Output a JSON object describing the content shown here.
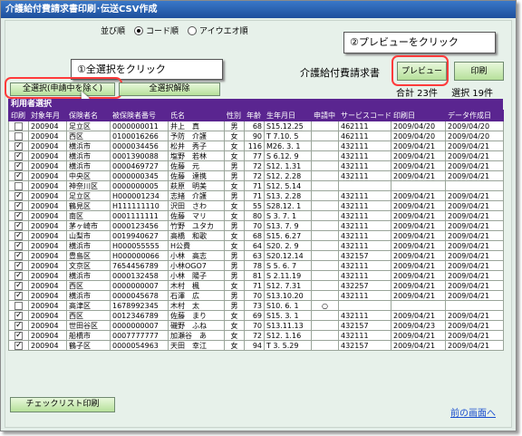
{
  "window": {
    "title": "介護給付費請求書印刷･伝送CSV作成"
  },
  "sort": {
    "label": "並び順",
    "options": [
      {
        "label": "コード順",
        "selected": true
      },
      {
        "label": "アイウエオ順",
        "selected": false
      }
    ]
  },
  "callouts": {
    "preview_hint": "②プレビューをクリック",
    "selectall_hint": "①全選択をクリック"
  },
  "header": {
    "doc_title": "介護給付費請求書",
    "preview_label": "プレビュー",
    "print_label": "印刷"
  },
  "toolbar": {
    "select_all_label": "全選択(申請中を除く)",
    "clear_all_label": "全選択解除"
  },
  "totals": {
    "total": "合計 23件",
    "selected": "選択 19件"
  },
  "section_label": "利用者選択",
  "table": {
    "columns": [
      "印刷",
      "対象年月",
      "保険者名",
      "被保険者番号",
      "氏名",
      "性別",
      "年齢",
      "生年月日",
      "申請中",
      "サービスコード",
      "印刷日",
      "データ作成日"
    ],
    "rows": [
      {
        "checked": false,
        "ym": "200904",
        "insurer": "足立区",
        "no": "0000000011",
        "name": "井上　真",
        "sex": "男",
        "age": "68",
        "birth": "S15.12.25",
        "pending": "",
        "svc": "462111",
        "printed": "2009/04/20",
        "created": "2009/04/20"
      },
      {
        "checked": false,
        "ym": "200904",
        "insurer": "西区",
        "no": "0100016266",
        "name": "予防　介護",
        "sex": "女",
        "age": "90",
        "birth": "T 7.10. 5",
        "pending": "",
        "svc": "462111",
        "printed": "2009/04/20",
        "created": "2009/04/20"
      },
      {
        "checked": true,
        "ym": "200904",
        "insurer": "横浜市",
        "no": "0000034456",
        "name": "松井　秀子",
        "sex": "女",
        "age": "116",
        "birth": "M26. 3. 1",
        "pending": "",
        "svc": "432111",
        "printed": "2009/04/21",
        "created": "2009/04/21"
      },
      {
        "checked": true,
        "ym": "200904",
        "insurer": "横浜市",
        "no": "0001390088",
        "name": "塩野　若林",
        "sex": "女",
        "age": "77",
        "birth": "S 6.12. 9",
        "pending": "",
        "svc": "432111",
        "printed": "2009/04/21",
        "created": "2009/04/21"
      },
      {
        "checked": true,
        "ym": "200904",
        "insurer": "横浜市",
        "no": "0000469727",
        "name": "佐藤　元",
        "sex": "男",
        "age": "72",
        "birth": "S12. 1.31",
        "pending": "",
        "svc": "432111",
        "printed": "2009/04/21",
        "created": "2009/04/21"
      },
      {
        "checked": true,
        "ym": "200904",
        "insurer": "中央区",
        "no": "0000000345",
        "name": "佐藤　達携",
        "sex": "男",
        "age": "72",
        "birth": "S12. 2.28",
        "pending": "",
        "svc": "432111",
        "printed": "2009/04/21",
        "created": "2009/04/21"
      },
      {
        "checked": false,
        "ym": "200904",
        "insurer": "神奈川区",
        "no": "0000000005",
        "name": "萩原　明美",
        "sex": "女",
        "age": "71",
        "birth": "S12. 5.14",
        "pending": "",
        "svc": "",
        "printed": "",
        "created": ""
      },
      {
        "checked": true,
        "ym": "200904",
        "insurer": "足立区",
        "no": "H000001234",
        "name": "志緒　介護",
        "sex": "男",
        "age": "71",
        "birth": "S13. 2.28",
        "pending": "",
        "svc": "432111",
        "printed": "2009/04/21",
        "created": "2009/04/21"
      },
      {
        "checked": true,
        "ym": "200904",
        "insurer": "鶴見区",
        "no": "H111111110",
        "name": "沢田　さわ",
        "sex": "女",
        "age": "55",
        "birth": "S28.12. 1",
        "pending": "",
        "svc": "432111",
        "printed": "2009/04/21",
        "created": "2009/04/21"
      },
      {
        "checked": true,
        "ym": "200904",
        "insurer": "南区",
        "no": "0001111111",
        "name": "佐藤　マリ",
        "sex": "女",
        "age": "80",
        "birth": "S 3. 7. 1",
        "pending": "",
        "svc": "432111",
        "printed": "2009/04/21",
        "created": "2009/04/21"
      },
      {
        "checked": true,
        "ym": "200904",
        "insurer": "茅ヶ崎市",
        "no": "0000123456",
        "name": "竹野　ユタカ",
        "sex": "男",
        "age": "70",
        "birth": "S13. 7. 9",
        "pending": "",
        "svc": "432111",
        "printed": "2009/04/21",
        "created": "2009/04/21"
      },
      {
        "checked": true,
        "ym": "200904",
        "insurer": "山梨市",
        "no": "0019940627",
        "name": "高橋　和歌",
        "sex": "女",
        "age": "68",
        "birth": "S15. 6.27",
        "pending": "",
        "svc": "432111",
        "printed": "2009/04/21",
        "created": "2009/04/21"
      },
      {
        "checked": true,
        "ym": "200904",
        "insurer": "横浜市",
        "no": "H000055555",
        "name": "H公費",
        "sex": "女",
        "age": "64",
        "birth": "S20. 2. 9",
        "pending": "",
        "svc": "432111",
        "printed": "2009/04/21",
        "created": "2009/04/21"
      },
      {
        "checked": true,
        "ym": "200904",
        "insurer": "豊島区",
        "no": "H000000066",
        "name": "小林　高志",
        "sex": "男",
        "age": "63",
        "birth": "S20.12.14",
        "pending": "",
        "svc": "432157",
        "printed": "2009/04/21",
        "created": "2009/04/21"
      },
      {
        "checked": true,
        "ym": "200904",
        "insurer": "文京区",
        "no": "7654456789",
        "name": "小林OGO7",
        "sex": "男",
        "age": "78",
        "birth": "S 5. 6. 7",
        "pending": "",
        "svc": "432111",
        "printed": "2009/04/21",
        "created": "2009/04/21"
      },
      {
        "checked": true,
        "ym": "200904",
        "insurer": "横浜市",
        "no": "0000132458",
        "name": "小林　陽子",
        "sex": "男",
        "age": "81",
        "birth": "S 2.11.19",
        "pending": "",
        "svc": "432111",
        "printed": "2009/04/21",
        "created": "2009/04/21"
      },
      {
        "checked": true,
        "ym": "200904",
        "insurer": "西区",
        "no": "0000000007",
        "name": "木村　楓",
        "sex": "女",
        "age": "71",
        "birth": "S12. 7.31",
        "pending": "",
        "svc": "432257",
        "printed": "2009/04/21",
        "created": "2009/04/21"
      },
      {
        "checked": true,
        "ym": "200904",
        "insurer": "横浜市",
        "no": "0000045678",
        "name": "石澤　広",
        "sex": "男",
        "age": "70",
        "birth": "S13.10.20",
        "pending": "",
        "svc": "432111",
        "printed": "2009/04/21",
        "created": "2009/04/21"
      },
      {
        "checked": false,
        "ym": "200904",
        "insurer": "高津区",
        "no": "1678992345",
        "name": "木村　太",
        "sex": "男",
        "age": "73",
        "birth": "S10. 6. 1",
        "pending": "○",
        "svc": "",
        "printed": "",
        "created": ""
      },
      {
        "checked": true,
        "ym": "200904",
        "insurer": "西区",
        "no": "0012346789",
        "name": "佐藤　まり",
        "sex": "女",
        "age": "69",
        "birth": "S15. 3. 1",
        "pending": "",
        "svc": "432111",
        "printed": "2009/04/21",
        "created": "2009/04/21"
      },
      {
        "checked": true,
        "ym": "200904",
        "insurer": "世田谷区",
        "no": "0000000007",
        "name": "磯野　ふね",
        "sex": "女",
        "age": "70",
        "birth": "S13.11.13",
        "pending": "",
        "svc": "432157",
        "printed": "2009/04/23",
        "created": "2009/04/21"
      },
      {
        "checked": true,
        "ym": "200904",
        "insurer": "船橋市",
        "no": "0007777777",
        "name": "加瀬谷　あ",
        "sex": "女",
        "age": "72",
        "birth": "S12. 1.16",
        "pending": "",
        "svc": "432111",
        "printed": "2009/04/21",
        "created": "2009/04/21"
      },
      {
        "checked": true,
        "ym": "200904",
        "insurer": "鶴子区",
        "no": "0000054963",
        "name": "天田　幸江",
        "sex": "女",
        "age": "94",
        "birth": "T 3. 5.29",
        "pending": "",
        "svc": "432157",
        "printed": "2009/04/21",
        "created": "2009/04/21"
      }
    ]
  },
  "footer": {
    "checklist_label": "チェックリスト印刷",
    "back_link": "前の画面へ"
  },
  "colors": {
    "header_purple": "#5a2590",
    "button_green": "#b6e09a",
    "highlight_red": "#ff3b3b",
    "title_blue": "#1d4f9c"
  }
}
